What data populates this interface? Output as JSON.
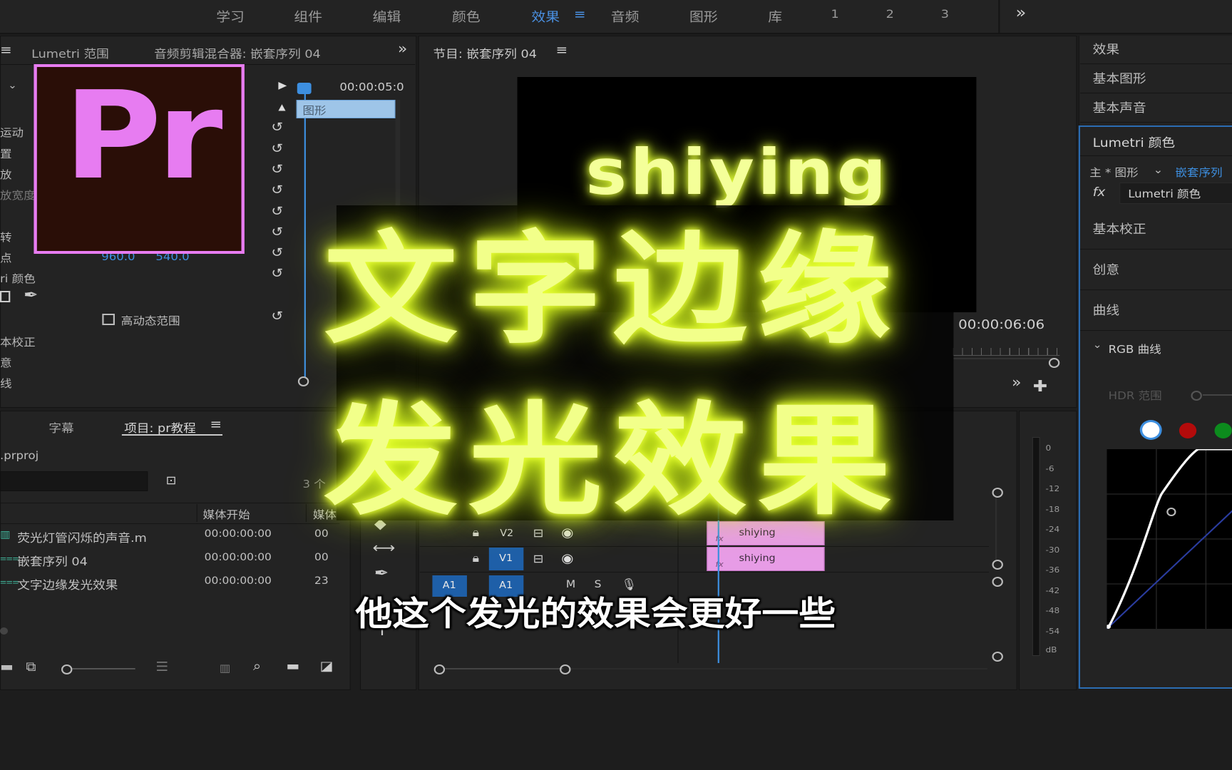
{
  "workspaces": {
    "items": [
      "学习",
      "组件",
      "编辑",
      "颜色",
      "效果",
      "音频",
      "图形",
      "库",
      "1",
      "2",
      "3"
    ],
    "active": "效果",
    "more": "»"
  },
  "source_panel": {
    "tab_lumetri_scope": "Lumetri 范围",
    "tab_audio_mixer": "音频剪辑混合器: 嵌套序列 04",
    "timecode": "00:00:05:0",
    "clip_label": "图形",
    "rows": [
      "运动",
      "置",
      "放",
      "放宽度",
      "",
      "转",
      "点",
      "ri 颜色"
    ],
    "anchor_x": "960.0",
    "anchor_y": "540.0",
    "hdr_label": "高动态范围",
    "lower_rows": [
      "本校正",
      "意",
      "线"
    ]
  },
  "program_monitor": {
    "title": "节目: 嵌套序列 04",
    "video_text": "shiying",
    "timecode": "00:00:06:06"
  },
  "project_panel": {
    "tab_captions": "字幕",
    "tab_project": "项目: pr教程",
    "file": ".prproj",
    "count": "3 个",
    "col_media_start": "媒体开始",
    "col_media_end": "媒体",
    "items": [
      {
        "name": "荧光灯管闪烁的声音.m",
        "start": "00:00:00:00",
        "end": "00"
      },
      {
        "name": "嵌套序列 04",
        "start": "00:00:00:00",
        "end": "00"
      },
      {
        "name": "文字边缘发光效果",
        "start": "00:00:00:00",
        "end": "23"
      }
    ]
  },
  "timeline": {
    "tracks": [
      {
        "label": "V2",
        "clip": "shiying"
      },
      {
        "label": "V1",
        "clip": "shiying"
      },
      {
        "label": "A1",
        "clip": ""
      }
    ],
    "meter_labels": [
      "0",
      "-6",
      "-12",
      "-18",
      "-24",
      "-30",
      "-36",
      "-42",
      "-48",
      "-54",
      "dB"
    ]
  },
  "lumetri_panel": {
    "rows": [
      "效果",
      "基本图形",
      "基本声音",
      "Lumetri 颜色"
    ],
    "master": "主 * 图形",
    "sequence": "嵌套序列",
    "fx_name": "Lumetri 颜色",
    "sections": [
      "基本校正",
      "创意",
      "曲线"
    ],
    "rgb_curves": "RGB 曲线",
    "hdr_range": "HDR 范围"
  },
  "logo": {
    "text": "Pr"
  },
  "overlay": {
    "line1": "文字边缘",
    "line2": "发光效果",
    "subtitle": "他这个发光的效果会更好一些"
  },
  "colors": {
    "accent": "#3d8fe0",
    "logo_purple": "#e77cf1",
    "logo_bg": "#2a0e07",
    "glow": "#eaff3a",
    "clip": "#e79ce6"
  }
}
